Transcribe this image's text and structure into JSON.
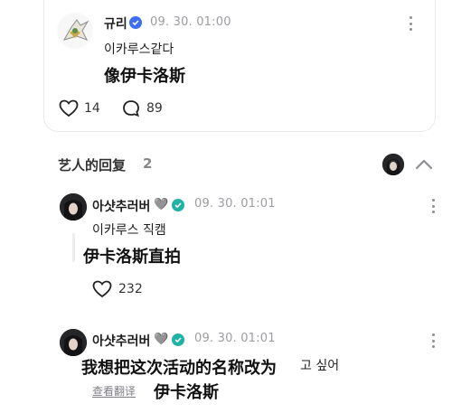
{
  "post": {
    "author": "규리",
    "timestamp": "09. 30. 01:00",
    "text": "이카루스같다",
    "subtitle": "像伊卡洛斯",
    "likes": "14",
    "comments": "89"
  },
  "artist_replies": {
    "title": "艺人的回复",
    "count": "2"
  },
  "replies": [
    {
      "author": "아샷추러버",
      "heart": "🩶",
      "timestamp": "09. 30. 01:01",
      "text": "이카루스 직캠",
      "subtitle": "伊卡洛斯直拍",
      "likes": "232"
    },
    {
      "author": "아샷추러버",
      "heart": "🩶",
      "timestamp": "09. 30. 01:01",
      "text_tail": "고 싶어",
      "subtitle_line1": "我想把这次活动的名称改为",
      "subtitle_line2": "伊卡洛斯",
      "translate_label": "查看翻译"
    }
  ],
  "colors": {
    "verified": "#3d6ef4",
    "muted": "#9c9ca2"
  }
}
